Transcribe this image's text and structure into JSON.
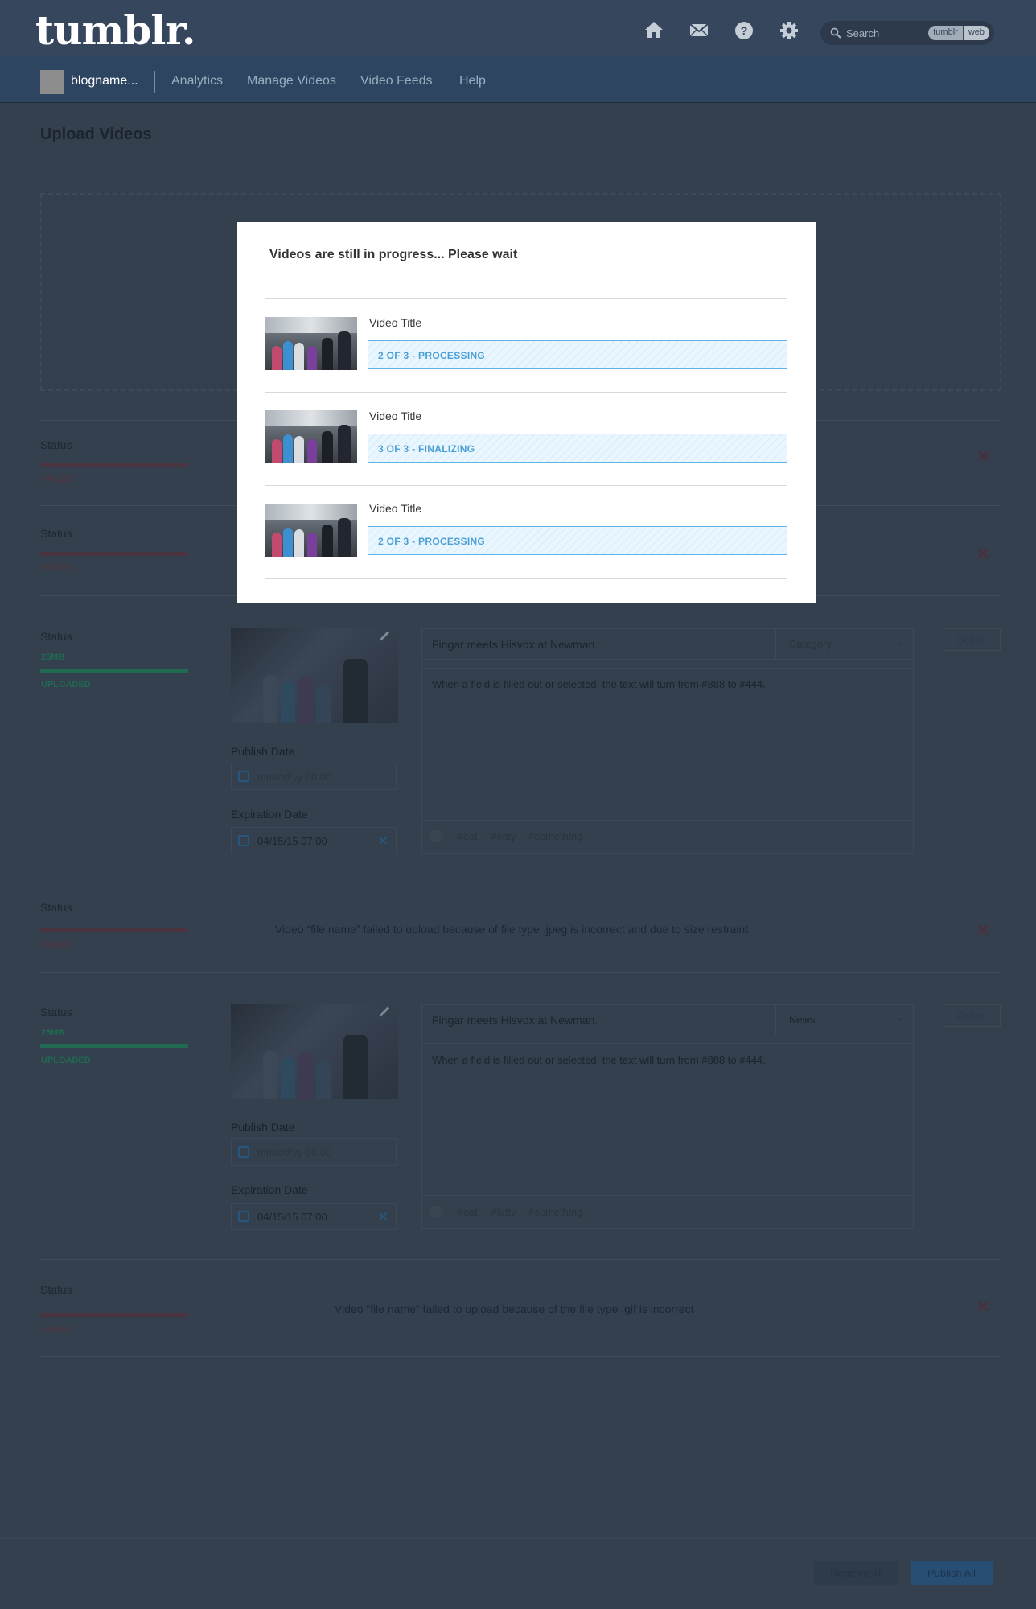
{
  "header": {
    "logo": "tumblr.",
    "icons": [
      "home-icon",
      "mail-icon",
      "help-icon",
      "gear-icon"
    ],
    "search": {
      "placeholder": "Search",
      "scope_options": [
        "tumblr",
        "web"
      ]
    }
  },
  "nav": {
    "blog_name": "blogname...",
    "links": [
      "Analytics",
      "Manage Videos",
      "Video Feeds",
      "Help"
    ]
  },
  "page": {
    "title": "Upload Videos"
  },
  "uploads": [
    {
      "status_label": "Status",
      "state": "FAILED"
    },
    {
      "status_label": "Status",
      "state": "FAILED"
    },
    {
      "status_label": "Status",
      "size": "25MB",
      "state": "UPLOADED",
      "publish_date_label": "Publish Date",
      "publish_date": "mm/dd/yy    00:00",
      "expiration_date_label": "Expiration Date",
      "expiration_date": "04/15/15    07:00",
      "title": "Fingar meets Hisvox at Newman.",
      "category": "Category",
      "description": "When a field is filled out or selected, the text will turn from #888 to #444.",
      "tags": [
        "#cat",
        "#kitty",
        "#something"
      ],
      "delete_label": "Delete"
    },
    {
      "status_label": "Status",
      "state": "FAILED",
      "message": "Video “file name” failed to upload because of file type .jpeg is incorrect and due to size restraint"
    },
    {
      "status_label": "Status",
      "size": "25MB",
      "state": "UPLOADED",
      "publish_date_label": "Publish Date",
      "publish_date": "mm/dd/yy    00:00",
      "expiration_date_label": "Expiration Date",
      "expiration_date": "04/15/15    07:00",
      "title": "Fingar meets Hisvox at Newman.",
      "category": "News",
      "description": "When a field is filled out or selected, the text will turn from #888 to #444.",
      "tags": [
        "#cat",
        "#kitty",
        "#something"
      ],
      "delete_label": "Delete"
    },
    {
      "status_label": "Status",
      "state": "FAILED",
      "message": "Video “file name” failed to upload because of the file type .gif is incorrect"
    }
  ],
  "footer": {
    "remove_all": "Remove All",
    "publish_all": "Publish All"
  },
  "modal": {
    "title": "Videos are still in progress... Please wait",
    "items": [
      {
        "video_title": "Video Title",
        "progress_text": "2 OF 3 - PROCESSING"
      },
      {
        "video_title": "Video Title",
        "progress_text": "3 OF 3 - FINALIZING"
      },
      {
        "video_title": "Video Title",
        "progress_text": "2 OF 3 - PROCESSING"
      }
    ]
  },
  "colors": {
    "header_bg": "#36465d",
    "nav_bg": "#2d4561",
    "overlay_bg": "#34404e",
    "progress_accent": "#4b9fd5",
    "uploaded_green": "#1f6a50",
    "failed_red": "#4a3440"
  }
}
